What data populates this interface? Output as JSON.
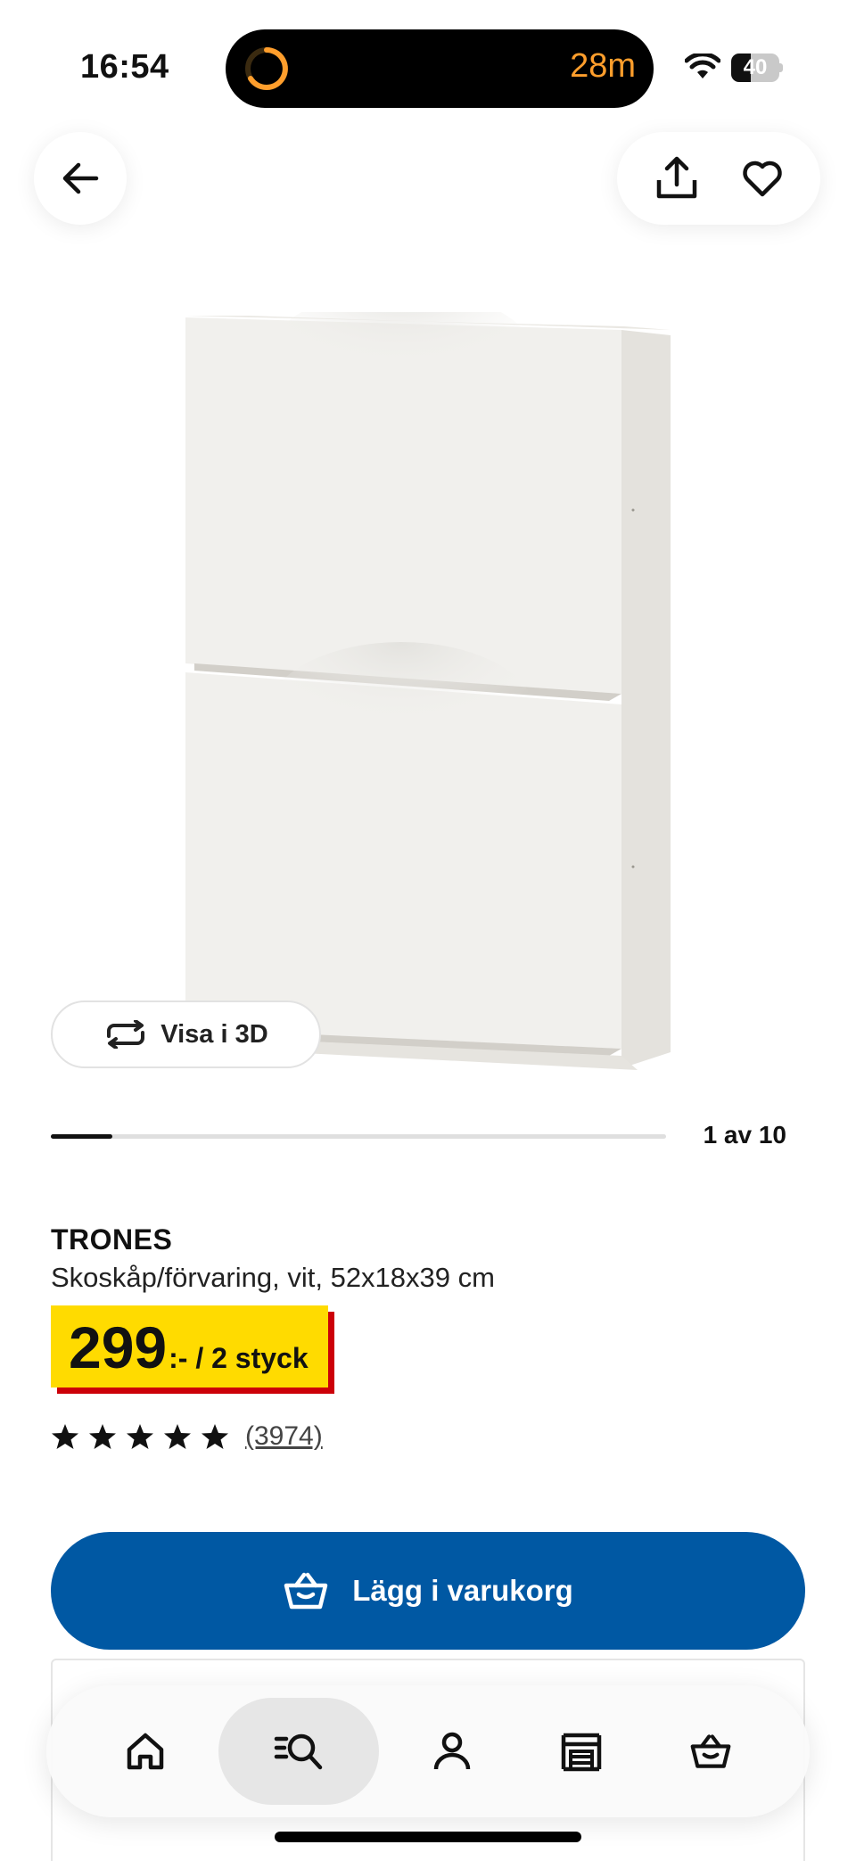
{
  "status_bar": {
    "time": "16:54",
    "activity_text": "28m",
    "battery_level": "40",
    "battery_fraction": 0.4
  },
  "carousel": {
    "counter": "1 av 10",
    "position_fraction": 0.1
  },
  "view_3d_label": "Visa i 3D",
  "product": {
    "name": "TRONES",
    "description": "Skoskåp/förvaring, vit, 52x18x39 cm",
    "price": "299",
    "price_suffix": ":- / 2 styck",
    "rating_stars": 5,
    "review_count": "(3974)"
  },
  "add_to_cart_label": "Lägg i varukorg",
  "tabs": [
    {
      "name": "home",
      "icon": "home-icon"
    },
    {
      "name": "search",
      "icon": "search-icon",
      "active": true
    },
    {
      "name": "profile",
      "icon": "person-icon"
    },
    {
      "name": "stores",
      "icon": "store-icon"
    },
    {
      "name": "cart",
      "icon": "cart-icon"
    }
  ],
  "colors": {
    "brand_blue": "#0058a3",
    "price_yellow": "#ffdb00",
    "price_red": "#cc0008",
    "activity_orange": "#ff9e2c"
  }
}
